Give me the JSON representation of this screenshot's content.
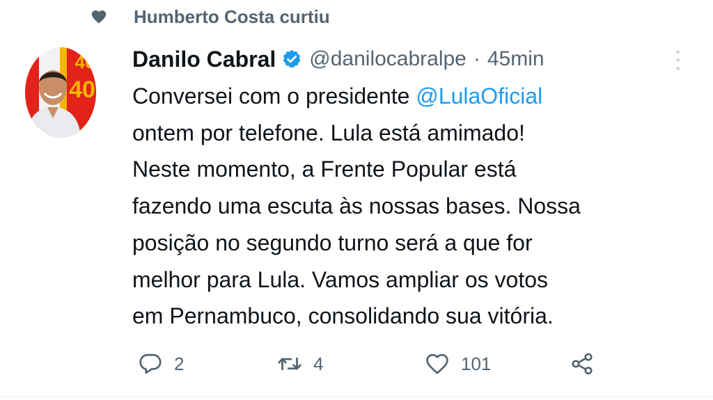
{
  "social_context": {
    "icon": "heart-icon",
    "text": "Humberto Costa curtiu"
  },
  "tweet": {
    "author": {
      "name": "Danilo Cabral",
      "verified": true,
      "handle": "@danilocabralpe",
      "avatar_badge": "40"
    },
    "separator": "·",
    "time": "45min",
    "text_lines": [
      {
        "before": "Conversei com o presidente ",
        "mention": "@LulaOficial"
      },
      {
        "text": "ontem por telefone. Lula está amimado!"
      },
      {
        "text": "Neste momento, a Frente Popular está"
      },
      {
        "text": "fazendo uma escuta às nossas bases. Nossa"
      },
      {
        "text": "posição no segundo turno será a que for"
      },
      {
        "text": "melhor para Lula. Vamos ampliar os votos"
      },
      {
        "text": "em Pernambuco, consolidando sua vitória."
      }
    ],
    "actions": {
      "reply_count": "2",
      "retweet_count": "4",
      "like_count": "101"
    }
  },
  "colors": {
    "text": "#0f1419",
    "secondary": "#536471",
    "link": "#1d9bf0",
    "verified": "#1d9bf0"
  }
}
